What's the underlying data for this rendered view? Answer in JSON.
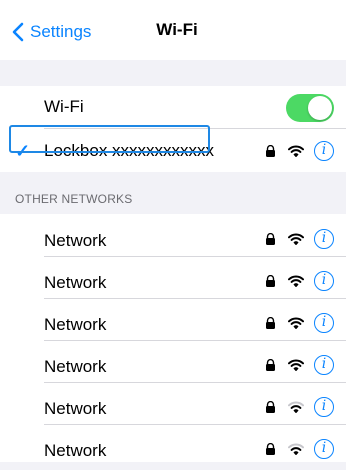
{
  "nav": {
    "back_label": "Settings",
    "title": "Wi-Fi"
  },
  "wifi": {
    "label": "Wi-Fi",
    "enabled": true,
    "toggle_color": "#4cd964"
  },
  "connected": {
    "name": "Lockbox xxxxxxxxxxxx",
    "checkmark": "✓",
    "highlight_color": "#1e88e5"
  },
  "other_networks": {
    "header": "OTHER NETWORKS",
    "items": [
      {
        "name": "Network",
        "locked": true,
        "signal": 3
      },
      {
        "name": "Network",
        "locked": true,
        "signal": 3
      },
      {
        "name": "Network",
        "locked": true,
        "signal": 3
      },
      {
        "name": "Network",
        "locked": true,
        "signal": 3
      },
      {
        "name": "Network",
        "locked": true,
        "signal": 2
      },
      {
        "name": "Network",
        "locked": true,
        "signal": 2
      }
    ]
  },
  "icons": {
    "info": "i",
    "accent_color": "#0a84ff"
  }
}
